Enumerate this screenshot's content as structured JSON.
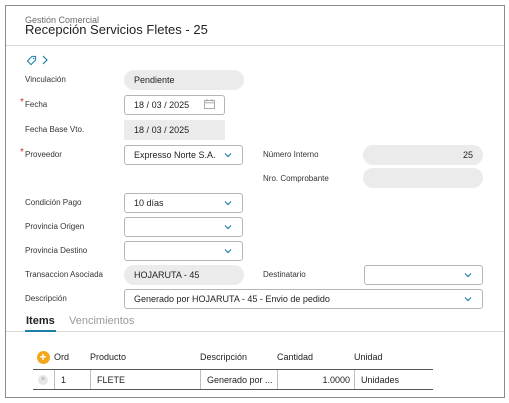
{
  "header": {
    "module": "Gestión Comercial",
    "title": "Recepción Servicios Fletes - 25"
  },
  "form": {
    "vinculacion": {
      "label": "Vinculación",
      "value": "Pendiente"
    },
    "fecha": {
      "label": "Fecha",
      "day": "18",
      "month": "03",
      "year": "2025",
      "sep": "/"
    },
    "fecha_base": {
      "label": "Fecha Base Vto.",
      "day": "18",
      "month": "03",
      "year": "2025",
      "sep": "/"
    },
    "proveedor": {
      "label": "Proveedor",
      "value": "Expresso Norte S.A."
    },
    "numero_interno": {
      "label": "Número Interno",
      "value": "25"
    },
    "nro_comprobante": {
      "label": "Nro. Comprobante",
      "value": ""
    },
    "condicion_pago": {
      "label": "Condición Pago",
      "value": "10 días"
    },
    "provincia_origen": {
      "label": "Provincia Origen",
      "value": ""
    },
    "provincia_destino": {
      "label": "Provincia Destino",
      "value": ""
    },
    "transaccion": {
      "label": "Transaccion Asociada",
      "value": "HOJARUTA - 45"
    },
    "destinatario": {
      "label": "Destinatario",
      "value": ""
    },
    "descripcion": {
      "label": "Descripción",
      "value": "Generado por HOJARUTA - 45 - Envio de pedido"
    },
    "required_mark": "*"
  },
  "tabs": [
    {
      "label": "Items"
    },
    {
      "label": "Vencimientos"
    }
  ],
  "grid": {
    "add_symbol": "+",
    "delete_symbol": "×",
    "columns": [
      "Ord",
      "Producto",
      "Descripción",
      "Cantidad",
      "Unidad"
    ],
    "rows": [
      {
        "ord": "1",
        "producto": "FLETE",
        "descripcion": "Generado por ...",
        "cantidad": "1.0000",
        "unidad": "Unidades"
      }
    ]
  },
  "icons": {
    "tag": "tag-icon",
    "expand": "chevron-right-icon",
    "calendar": "calendar-icon",
    "dropdown": "chevron-down-icon"
  },
  "colors": {
    "accent": "#1e7fa8",
    "add_button": "#f2a71b",
    "required": "#c0392b",
    "readonly_bg": "#ebebeb"
  }
}
